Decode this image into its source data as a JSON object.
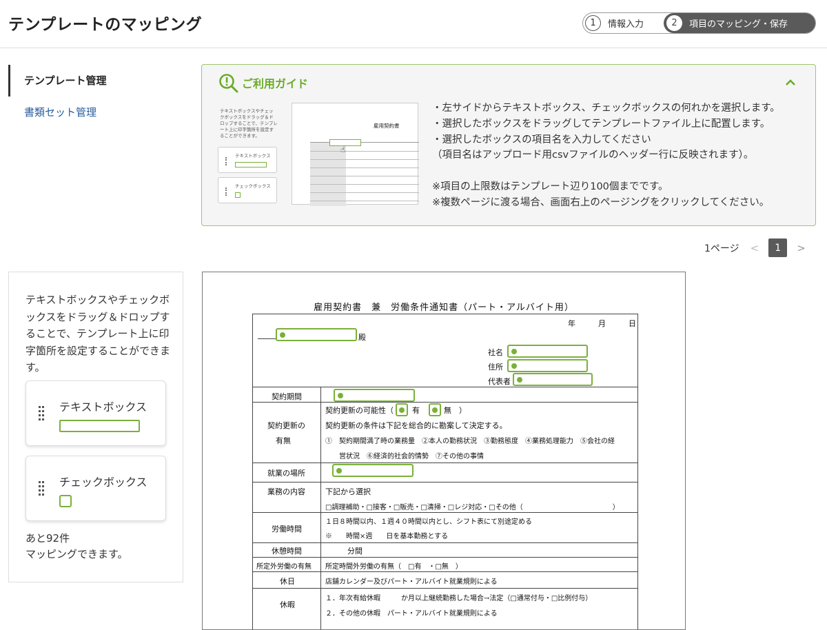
{
  "header": {
    "title": "テンプレートのマッピング",
    "steps": [
      {
        "num": "1",
        "label": "情報入力"
      },
      {
        "num": "2",
        "label": "項目のマッピング・保存"
      }
    ]
  },
  "sidebar": {
    "items": [
      {
        "label": "テンプレート管理"
      },
      {
        "label": "書類セット管理"
      }
    ]
  },
  "guide": {
    "title": "ご利用ガイド",
    "lines": [
      "・左サイドからテキストボックス、チェックボックスの何れかを選択します。",
      "・選択したボックスをドラッグしてテンプレートファイル上に配置します。",
      "・選択したボックスの項目名を入力してください",
      "（項目名はアップロード用csvファイルのヘッダー行に反映されます）。",
      "",
      "※項目の上限数はテンプレート辺り100個までです。",
      "※複数ページに渡る場合、画面右上のページングをクリックしてください。"
    ],
    "thumb": {
      "desc": "テキストボックスやチェックボックスをドラッグ＆ドロップすることで、テンプレート上に印字箇所を設定することができます。",
      "text_box": "テキストボックス",
      "check_box": "チェックボックス",
      "doc_title": "雇用契約書"
    }
  },
  "paging": {
    "label": "1ページ",
    "prev": "<",
    "current": "1",
    "next": ">"
  },
  "palette": {
    "description": "テキストボックスやチェックボックスをドラッグ＆ドロップすることで、テンプレート上に印字箇所を設定することができます。",
    "text_box_label": "テキストボックス",
    "check_box_label": "チェックボックス",
    "remaining_1": "あと92件",
    "remaining_2": "マッピングできます。"
  },
  "document": {
    "title": "雇用契約書　兼　労働条件通知書（パート・アルバイト用）",
    "date": "年　　　月　　　日",
    "dono": "殿",
    "company": "社名",
    "address": "住所",
    "representative": "代表者",
    "rows": {
      "period": "契約期間",
      "renewal_label_1": "契約更新の",
      "renewal_label_2": "有無",
      "renewal_line1a": "契約更新の可能性（",
      "renewal_line1b": "有　・",
      "renewal_line1c": "無　）",
      "renewal_line2": "契約更新の条件は下記を総合的に勘案して決定する。",
      "renewal_line3": "①　契約期間満了時の業務量　②本人の勤務状況　③勤務態度　④業務処理能力　⑤会社の経",
      "renewal_line4": "営状況　⑥経済的社会的情勢　⑦その他の事情",
      "workplace": "就業の場所",
      "duty": "業務の内容",
      "duty_line1": "下記から選択",
      "duty_line2": "□調理補助・□接客・□販売・□清掃・□レジ対応・□その他（　　　　　　　　　　　　　）",
      "hours": "労働時間",
      "hours_line1": "１日８時間以内、１週４０時間以内とし、シフト表にて別途定める",
      "hours_line2": "※　　時間×週　　日を基本勤務とする",
      "break": "休憩時間",
      "break_val": "分間",
      "overtime": "所定外労働の有無",
      "overtime_val": "所定時間外労働の有無（　□有　・□無　）",
      "holiday": "休日",
      "holiday_val": "店舗カレンダー及びパート・アルバイト就業規則による",
      "leave": "休暇",
      "leave_line1": "１．年次有給休暇　　　か月以上継続勤務した場合→法定（□通常付与・□比例付与）",
      "leave_line2": "２．その他の休暇　パート・アルバイト就業規則による"
    }
  },
  "colors": {
    "accent_green": "#7ab03a",
    "guide_title_green": "#6aac28",
    "link_blue": "#2a5d9f",
    "step_active": "#5a5a5a"
  }
}
